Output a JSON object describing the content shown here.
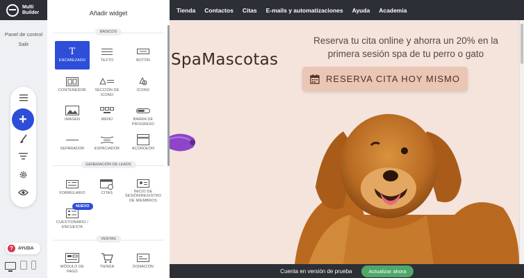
{
  "app": {
    "logo_line1": "Multi",
    "logo_line2": "Builder"
  },
  "sidebar": {
    "panel_label": "Panel de control",
    "exit_label": "Salir",
    "help_label": "AYUDA",
    "tools": [
      "menu-icon",
      "add-icon",
      "brush-icon",
      "filter-icon",
      "gear-icon",
      "eye-icon"
    ]
  },
  "topnav": {
    "items": [
      "Tienda",
      "Contactos",
      "Citas",
      "E-mails y automatizaciones",
      "Ayuda",
      "Academia"
    ]
  },
  "widgets": {
    "title": "Añadir widget",
    "sections": [
      "BÁSICOS",
      "GENERACIÓN DE LEADS",
      "VENTAS"
    ],
    "basic": [
      "ENCABEZADO",
      "TEXTO",
      "BOTÓN",
      "CONTENEDOR",
      "SECCIÓN DE ÍCONO",
      "ÍCONO",
      "IMAGEN",
      "MENÚ",
      "BARRA DE PROGRESO",
      "SEPARADOR",
      "ESPACIADOR",
      "ACORDEÓN"
    ],
    "leads": [
      "FORMULARIO",
      "CITAS",
      "INICIO DE SESIÓN/REGISTRO DE MIEMBROS",
      "CUESTIONARIO / ENCUESTA"
    ],
    "new_badge": "NUEVO",
    "sales": [
      "MÓDULO DE PAGO",
      "TIENDA",
      "DONACIÓN"
    ]
  },
  "canvas": {
    "brand": "SpaMascotas",
    "promo_line1": "Reserva tu cita online y ahorra un 20% en la",
    "promo_line2": "primera sesión spa de tu perro o gato",
    "cta": "RESERVA CITA HOY MISMO",
    "accent": "#ebc6b5",
    "background": "#f4e4dc"
  },
  "trial": {
    "text": "Cuenta en versión de prueba",
    "button": "Actualizar ahora"
  }
}
